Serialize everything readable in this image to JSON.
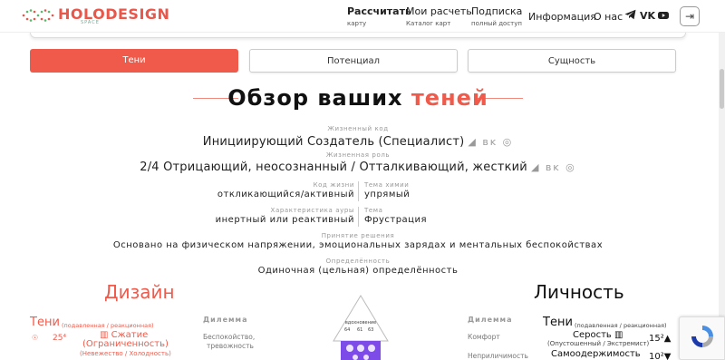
{
  "header": {
    "logo_text": "HOLODESIGN",
    "logo_sub": "SPACE",
    "nav": [
      {
        "label": "Рассчитать",
        "sub": "карту",
        "active": true
      },
      {
        "label": "Мои расчеты",
        "sub": "Каталог карт",
        "active": false
      },
      {
        "label": "Подписка",
        "sub": "полный доступ",
        "active": false
      },
      {
        "label": "Информация",
        "sub": "",
        "active": false
      },
      {
        "label": "О нас",
        "sub": "",
        "active": false
      }
    ],
    "social": [
      "telegram-icon",
      "vk-icon",
      "youtube-icon"
    ],
    "logout_icon": "logout-icon"
  },
  "tabs": [
    {
      "label": "Тени",
      "active": true
    },
    {
      "label": "Потенциал",
      "active": false
    },
    {
      "label": "Сущность",
      "active": false
    }
  ],
  "title": {
    "main": "Обзор ваших ",
    "accent": "теней"
  },
  "life_code": {
    "label": "Жизненный код",
    "value": "Инициирующий Создатель (Специалист)"
  },
  "life_role": {
    "label": "Жизненная роль",
    "value": "2/4 Отрицающий, неосознанный / Отталкивающий, жесткий"
  },
  "life_code_item": {
    "label": "Код жизни",
    "value": "откликающийся/активный"
  },
  "chemistry": {
    "label": "Тема химии",
    "value": "упрямый"
  },
  "aura": {
    "label": "Характеристика ауры",
    "value": "инертный или реактивный"
  },
  "theme": {
    "label": "Тема",
    "value": "Фрустрация"
  },
  "decision": {
    "label": "Принятие решения",
    "value": "Основано на физическом напряжении, эмоциональных зарядах и ментальных беспокойствах"
  },
  "definition": {
    "label": "Определённость",
    "value": "Одиночная (цельная) определённость"
  },
  "design": {
    "title": "Дизайн",
    "shadows_label": "Тени",
    "shadows_sub": "(подавленная / реакционная)",
    "dilemma_label": "Дилемма",
    "row_num": "25⁴",
    "row_value": "Сжатие",
    "row_value2": "(Ограниченность)",
    "row_sub": "(Невежество / Холодность)",
    "dilemma_value": "Беспокойство,",
    "dilemma_value2": "тревожность"
  },
  "personality": {
    "title": "Личность",
    "shadows_label": "Тени",
    "shadows_sub": "(подавленная / реакционная)",
    "dilemma_label": "Дилемма",
    "dilemma_value1": "Комфорт",
    "dilemma_value2": "Неприличимость",
    "row1_value": "Серость",
    "row1_sub": "(Опустошенный / Экстремист)",
    "row1_num": "15²▲",
    "row2_value": "Самоодержимость",
    "row2_num": "10²▼"
  },
  "bodygraph": {
    "label": "вдохновение",
    "gates": [
      "64",
      "61",
      "63"
    ]
  }
}
